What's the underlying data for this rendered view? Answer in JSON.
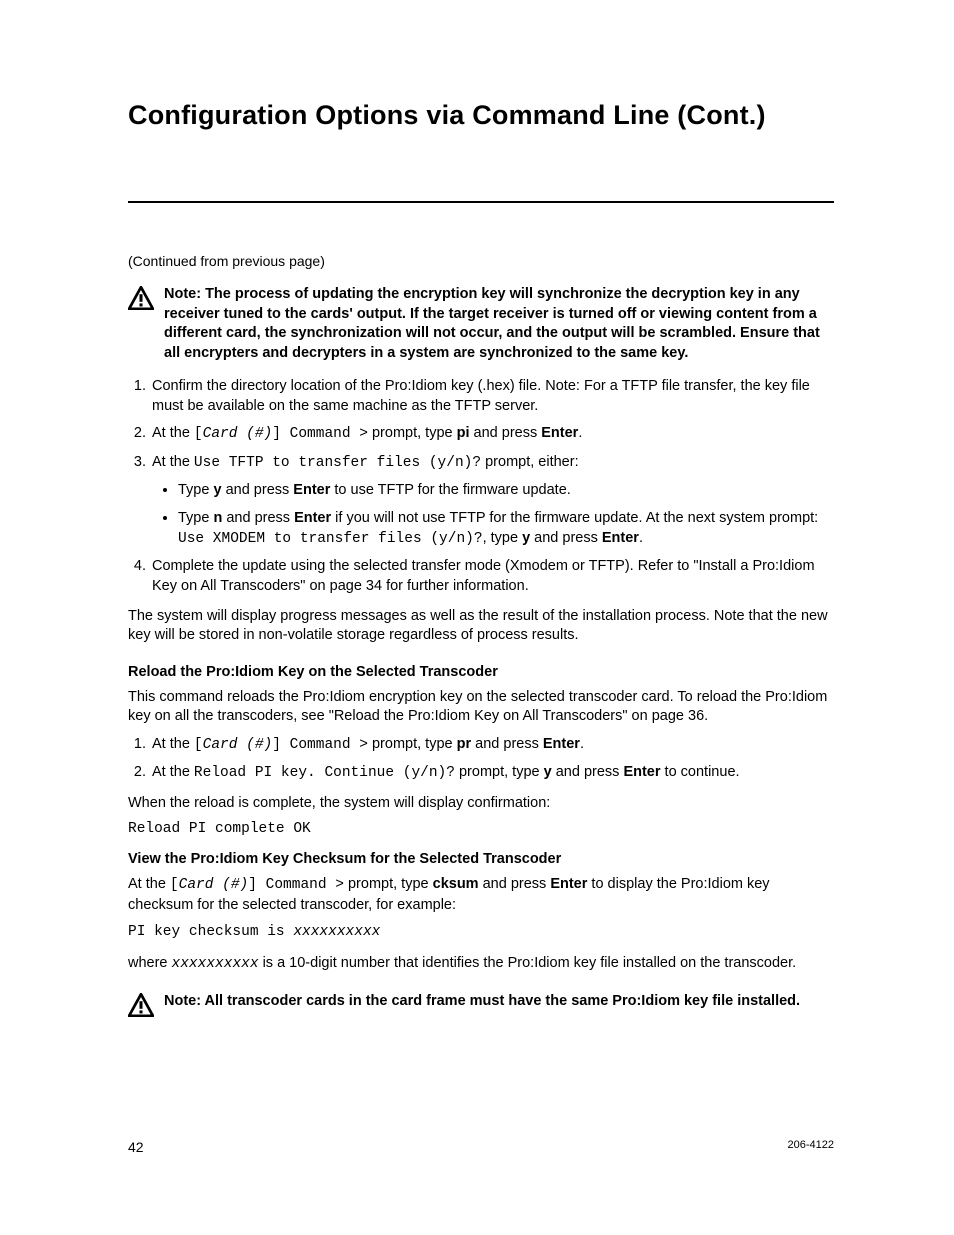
{
  "title": "Configuration Options via Command Line (Cont.)",
  "continued": "(Continued from previous page)",
  "note1": "Note: The process of updating the encryption key will synchronize the decryption key in any receiver tuned to the cards' output. If the target receiver is turned off or viewing content from a different card, the synchronization will not occur, and the output will be scrambled. Ensure that all encrypters and decrypters in a system are synchronized to the same key.",
  "step1": "Confirm the directory location of the Pro:Idiom key (.hex) file. Note: For a TFTP file transfer, the key file must be available on the same machine as the TFTP server.",
  "step2_a": "At the ",
  "step2_code": "[Card (#)] Command >",
  "step2_b": " prompt, type ",
  "step2_c": "pi",
  "step2_d": " and press ",
  "step2_e": "Enter",
  "step2_f": ".",
  "step3_a": "At the ",
  "step3_code": "Use TFTP to transfer files (y/n)?",
  "step3_b": " prompt, either:",
  "b1_a": "Type ",
  "b1_b": "y",
  "b1_c": " and press ",
  "b1_d": "Enter",
  "b1_e": " to use TFTP for the firmware update.",
  "b2_a": "Type ",
  "b2_b": "n",
  "b2_c": " and press ",
  "b2_d": "Enter",
  "b2_e": " if you will not use TFTP for the firmware update. At the next system prompt: ",
  "b2_code": "Use XMODEM to transfer files (y/n)?",
  "b2_f": ", type ",
  "b2_g": "y",
  "b2_h": " and press ",
  "b2_i": "Enter",
  "b2_j": ".",
  "step4": "Complete the update using the selected transfer mode (Xmodem or TFTP). Refer to \"Install a Pro:Idiom Key on All Transcoders\" on page 34 for further information.",
  "post_steps": "The system will display progress messages as well as the result of the installation process. Note that the new key will be stored in non-volatile storage regardless of process results.",
  "sub1": "Reload the Pro:Idiom Key on the Selected Transcoder",
  "sub1_p": "This command reloads the Pro:Idiom encryption key on the selected transcoder card. To reload the Pro:Idiom key on all the transcoders, see \"Reload the Pro:Idiom Key on All Transcoders\" on page 36.",
  "r1_a": "At the ",
  "r1_code": "[Card (#)] Command >",
  "r1_b": " prompt, type ",
  "r1_c": "pr",
  "r1_d": " and press ",
  "r1_e": "Enter",
  "r1_f": ".",
  "r2_a": "At the ",
  "r2_code": "Reload PI key. Continue (y/n)?",
  "r2_b": " prompt, type ",
  "r2_c": "y",
  "r2_d": " and press ",
  "r2_e": "Enter",
  "r2_f": " to continue.",
  "reload_done": "When the reload is complete, the system will display confirmation:",
  "reload_code": "Reload PI complete OK",
  "sub2": "View the Pro:Idiom Key Checksum for the Selected Transcoder",
  "v_a": "At the ",
  "v_code": "[Card (#)] Command >",
  "v_b": " prompt, type ",
  "v_c": "cksum",
  "v_d": " and press ",
  "v_e": "Enter",
  "v_f": " to display the Pro:Idiom key checksum for the selected transcoder, for example:",
  "cksum_code_a": "PI key checksum is ",
  "cksum_code_b": "xxxxxxxxxx",
  "w_a": "where ",
  "w_b": "xxxxxxxxxx",
  "w_c": " is a 10-digit number that identifies the Pro:Idiom key file installed on the transcoder.",
  "note2": "Note: All transcoder cards in the card frame must have the same Pro:Idiom key file installed.",
  "page_number": "42",
  "doc_number": "206-4122"
}
